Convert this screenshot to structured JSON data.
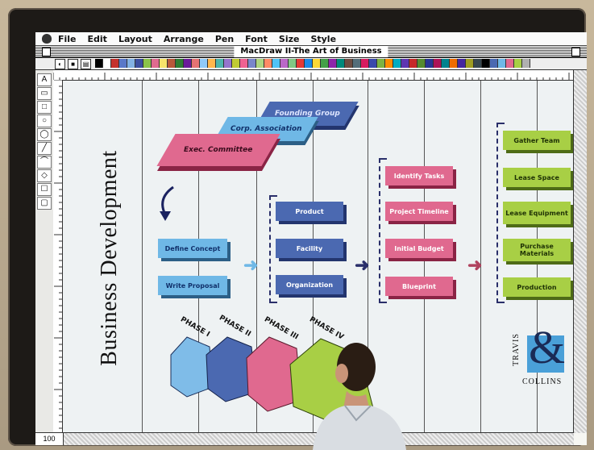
{
  "menubar": {
    "items": [
      "File",
      "Edit",
      "Layout",
      "Arrange",
      "Pen",
      "Font",
      "Size",
      "Style"
    ]
  },
  "window": {
    "title": "MacDraw II-The Art of Business"
  },
  "palette": {
    "colors": [
      "#000000",
      "#ffffff",
      "#c4312d",
      "#5a78c8",
      "#83b2e4",
      "#3c4fa0",
      "#8bc34a",
      "#e06a8f",
      "#f7e36b",
      "#b8573a",
      "#2e7d32",
      "#6a1b9a",
      "#e57373",
      "#90caf9",
      "#ffb74d",
      "#4db6ac",
      "#9575cd",
      "#c0ca33",
      "#f06292",
      "#7986cb",
      "#aed581",
      "#ff8a65",
      "#4fc3f7",
      "#ba68c8",
      "#81c784",
      "#e53935",
      "#1e88e5",
      "#fdd835",
      "#43a047",
      "#8e24aa",
      "#00897b",
      "#6d4c41",
      "#546e7a",
      "#d81b60",
      "#3949ab",
      "#7cb342",
      "#fb8c00",
      "#00acc1",
      "#5e35b1",
      "#c62828",
      "#558b2f",
      "#283593",
      "#ad1457",
      "#00838f",
      "#ef6c00",
      "#4527a0",
      "#9e9d24",
      "#37474f",
      "#000000",
      "#4b69b1",
      "#6fb8e6",
      "#e0698f",
      "#a8cf45",
      "#b0b0b0"
    ]
  },
  "tools": [
    "A",
    "▭",
    "□",
    "○",
    "◯",
    "╱",
    "⌒",
    "◇",
    "☐",
    "▢"
  ],
  "zoom": {
    "label": "100"
  },
  "diagram": {
    "title": "Business Development",
    "group": [
      "Founding Group",
      "Corp. Association",
      "Exec. Committee"
    ],
    "col1": [
      "Define Concept",
      "Write Proposal"
    ],
    "col2": [
      "Product",
      "Facility",
      "Organization"
    ],
    "col3": [
      "Identify Tasks",
      "Project Timeline",
      "Initial Budget",
      "Blueprint"
    ],
    "col4": [
      "Gather Team",
      "Lease Space",
      "Lease Equipment",
      "Purchase Materials",
      "Production"
    ],
    "phases": [
      "PHASE I",
      "PHASE II",
      "PHASE III",
      "PHASE IV"
    ],
    "logo": {
      "line1": "TRAVIS",
      "amp": "&",
      "line2": "COLLINS"
    }
  },
  "colors": {
    "blue": "#4b69b1",
    "light_blue": "#6fb8e6",
    "pink": "#e0698f",
    "green": "#a8cf45"
  }
}
